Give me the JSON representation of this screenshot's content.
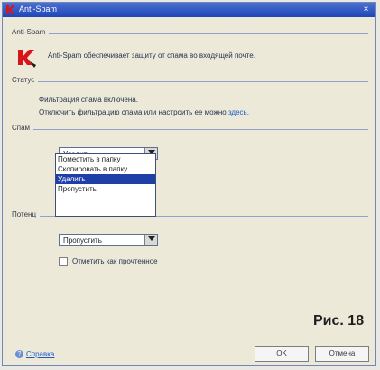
{
  "window": {
    "title": "Anti-Spam",
    "close_glyph": "×"
  },
  "sections": {
    "antispam": "Anti-Spam",
    "status": "Статус",
    "spam": "Спам",
    "potential": "Потенц"
  },
  "intro_text": "Anti-Spam обеспечивает защиту от спама во входящей почте.",
  "status_lines": {
    "line1": "Фильтрация спама включена.",
    "line2": "Отключить фильтрацию спама или настроить ее можно",
    "link": "здесь."
  },
  "spam_action": {
    "selected": "Удалить",
    "options": [
      "Поместить в папку",
      "Скопировать в папку",
      "Удалить",
      "Пропустить"
    ],
    "highlighted_index": 2
  },
  "potential_action": {
    "selected": "Пропустить"
  },
  "mark_read": {
    "label": "Отметить как прочтенное"
  },
  "figure_label": "Рис. 18",
  "footer": {
    "help": "Справка",
    "ok": "OK",
    "cancel": "Отмена"
  },
  "colors": {
    "title_bar": "#1f45b8",
    "selection": "#1f3fa8",
    "logo_red": "#d7161c",
    "link": "#1d58d1"
  }
}
